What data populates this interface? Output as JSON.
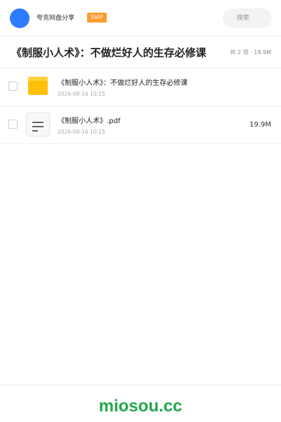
{
  "header": {
    "brand": "夸克网盘分享",
    "badge": "SVIP",
    "search_placeholder": "搜索"
  },
  "share": {
    "title": "《制服小人术》：不做烂好人的生存必修课",
    "summary": "共 2 项 · 19.9M"
  },
  "files": [
    {
      "name": "《制服小人术》：不做烂好人的生存必修课",
      "date": "2026-08-16 10:15",
      "size": "",
      "type": "folder-icon"
    },
    {
      "name": "《制服小人术》.pdf",
      "date": "2026-08-16 10:15",
      "size": "19.9M",
      "type": "document-icon"
    }
  ],
  "footer": {
    "watermark": "miosou.cc"
  },
  "colors": {
    "accent": "#2f7bff",
    "badge": "#ff9a2e",
    "folder": "#ffc107",
    "watermark": "#22a84a"
  }
}
